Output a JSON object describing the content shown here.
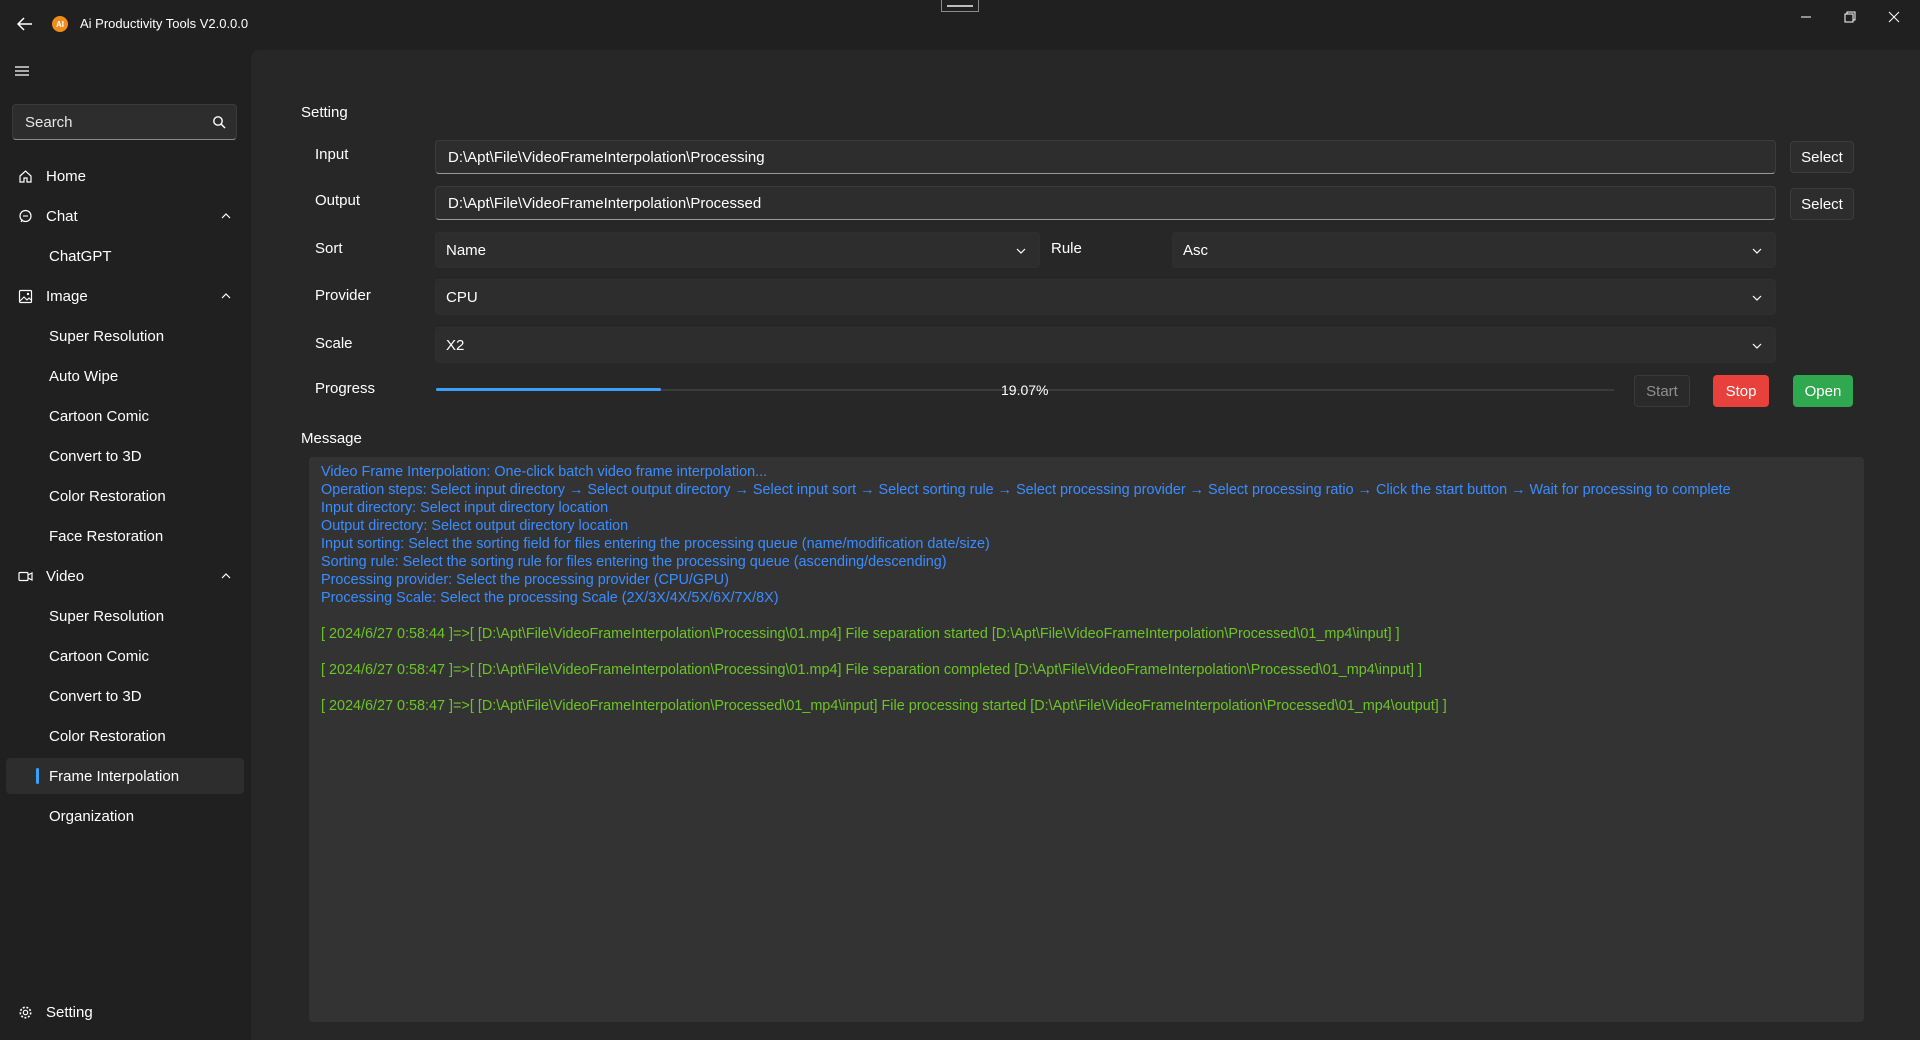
{
  "app": {
    "title": "Ai Productivity Tools V2.0.0.0",
    "logo_text": "AI"
  },
  "sidebar": {
    "search_placeholder": "Search",
    "items": [
      {
        "label": "Home",
        "icon": "home-icon"
      },
      {
        "label": "Chat",
        "icon": "chat-icon",
        "expanded": true
      },
      {
        "label": "ChatGPT"
      },
      {
        "label": "Image",
        "icon": "image-icon",
        "expanded": true
      },
      {
        "label": "Super Resolution"
      },
      {
        "label": "Auto Wipe"
      },
      {
        "label": "Cartoon Comic"
      },
      {
        "label": "Convert to 3D"
      },
      {
        "label": "Color Restoration"
      },
      {
        "label": "Face Restoration"
      },
      {
        "label": "Video",
        "icon": "video-icon",
        "expanded": true
      },
      {
        "label": "Super Resolution"
      },
      {
        "label": "Cartoon Comic"
      },
      {
        "label": "Convert to 3D"
      },
      {
        "label": "Color Restoration"
      },
      {
        "label": "Frame Interpolation",
        "selected": true
      },
      {
        "label": "Organization"
      }
    ],
    "setting_label": "Setting"
  },
  "main": {
    "setting_title": "Setting",
    "input_label": "Input",
    "input_value": "D:\\Apt\\File\\VideoFrameInterpolation\\Processing",
    "output_label": "Output",
    "output_value": "D:\\Apt\\File\\VideoFrameInterpolation\\Processed",
    "select_label": "Select",
    "sort_label": "Sort",
    "sort_value": "Name",
    "rule_label": "Rule",
    "rule_value": "Asc",
    "provider_label": "Provider",
    "provider_value": "CPU",
    "scale_label": "Scale",
    "scale_value": "X2",
    "progress_label": "Progress",
    "progress_value": 0.1907,
    "progress_text": "19.07%",
    "start_label": "Start",
    "stop_label": "Stop",
    "open_label": "Open",
    "message_title": "Message",
    "info_lines": [
      "Video Frame Interpolation: One-click batch video frame interpolation...",
      "Operation steps: Select input directory → Select output directory → Select input sort → Select sorting rule → Select processing provider → Select processing ratio → Click the start button → Wait for processing to complete",
      "Input directory: Select input directory location",
      "Output directory: Select output directory location",
      "Input sorting: Select the sorting field for files entering the processing queue (name/modification date/size)",
      "Sorting rule: Select the sorting rule for files entering the processing queue (ascending/descending)",
      "Processing provider: Select the processing provider (CPU/GPU)",
      "Processing Scale: Select the processing Scale (2X/3X/4X/5X/6X/7X/8X)"
    ],
    "log_lines": [
      "[ 2024/6/27 0:58:44 ]=>[ [D:\\Apt\\File\\VideoFrameInterpolation\\Processing\\01.mp4] File separation started [D:\\Apt\\File\\VideoFrameInterpolation\\Processed\\01_mp4\\input] ]",
      "[ 2024/6/27 0:58:47 ]=>[ [D:\\Apt\\File\\VideoFrameInterpolation\\Processing\\01.mp4] File separation completed [D:\\Apt\\File\\VideoFrameInterpolation\\Processed\\01_mp4\\input] ]",
      "[ 2024/6/27 0:58:47 ]=>[ [D:\\Apt\\File\\VideoFrameInterpolation\\Processed\\01_mp4\\input] File processing started [D:\\Apt\\File\\VideoFrameInterpolation\\Processed\\01_mp4\\output] ]"
    ]
  },
  "colors": {
    "accent": "#3aa0ff",
    "stop": "#e8403a",
    "open": "#2fa84f",
    "info_text": "#3b8dff",
    "log_text": "#6cc428"
  }
}
